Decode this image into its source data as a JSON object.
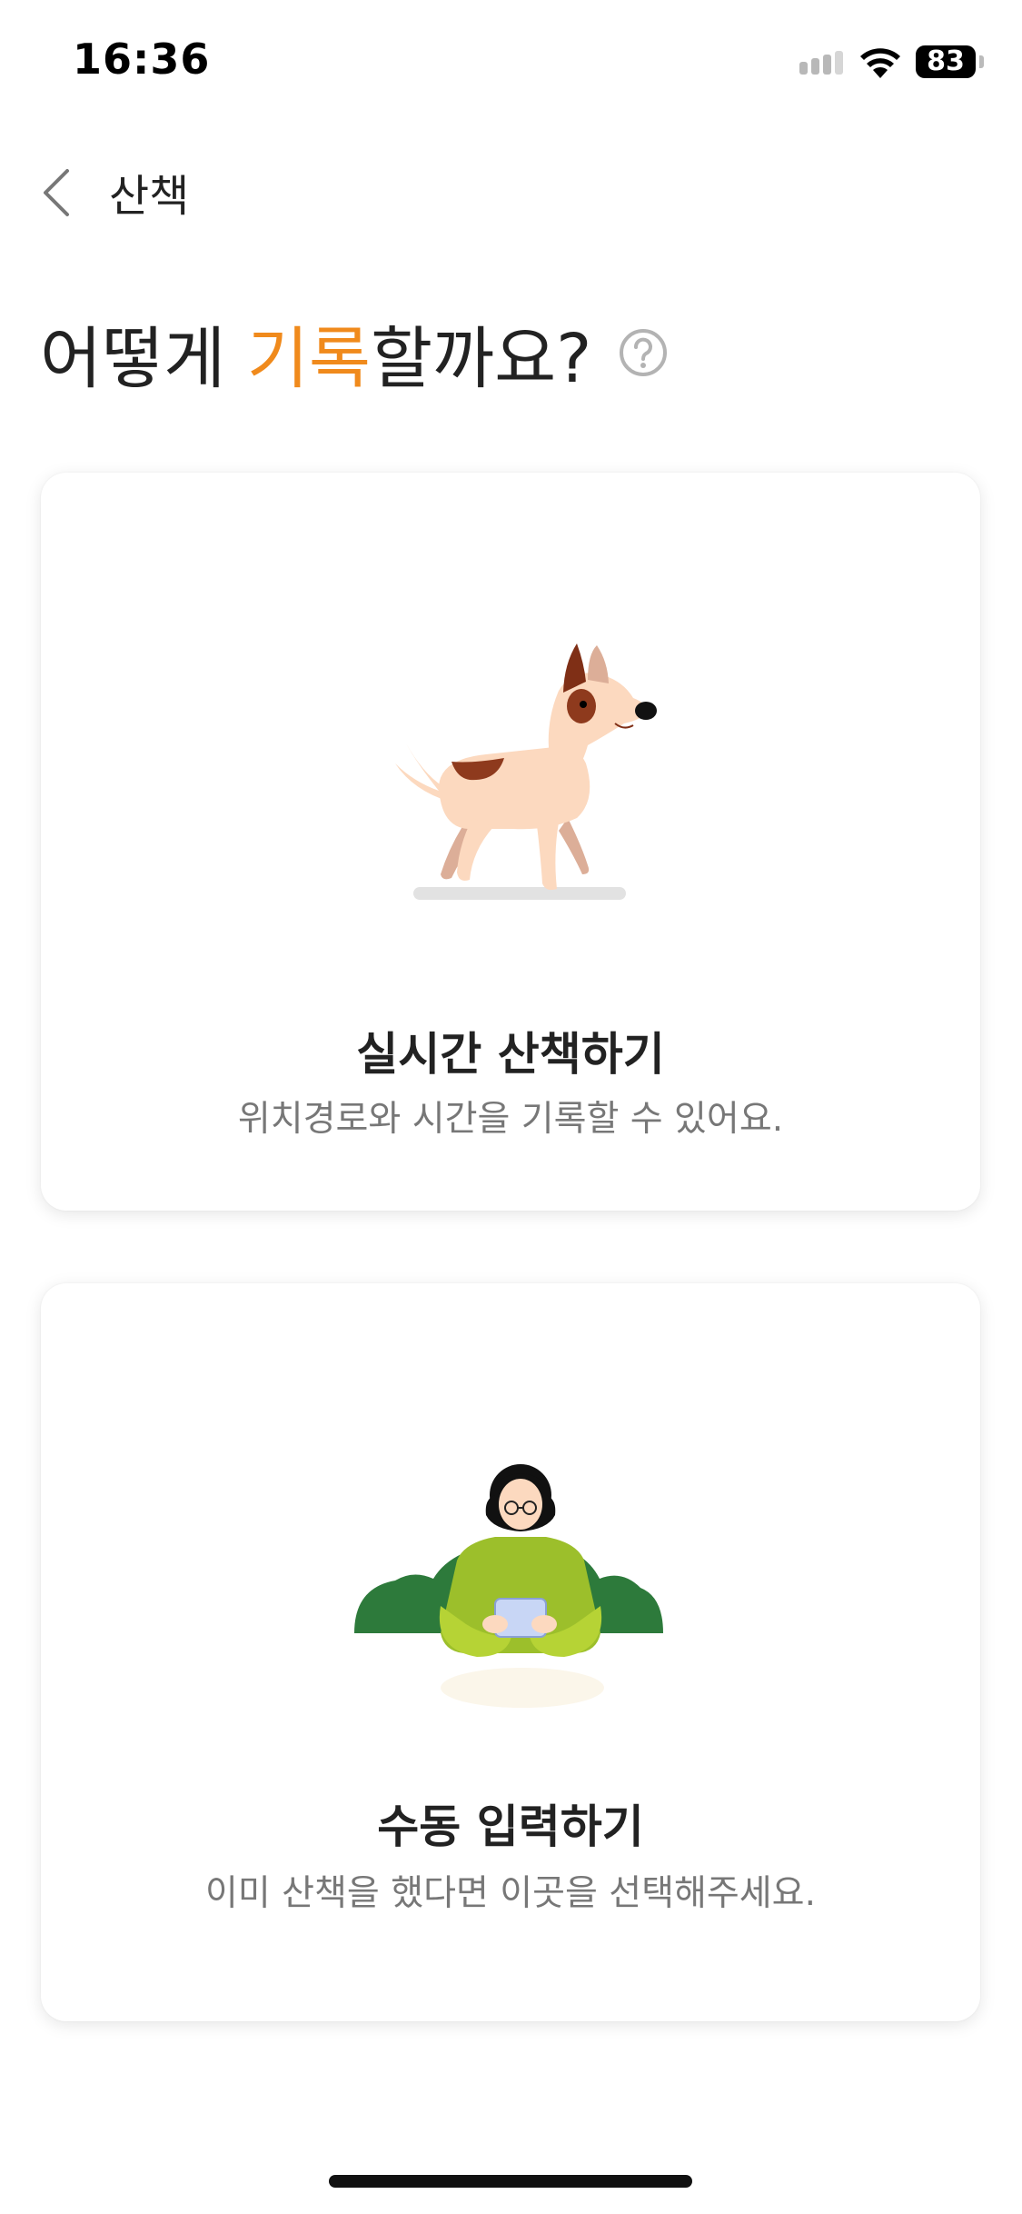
{
  "status_bar": {
    "time": "16:36",
    "battery": "83"
  },
  "nav": {
    "title": "산책",
    "back_icon": "chevron-left-icon"
  },
  "headline": {
    "prefix": "어떻게 ",
    "accent": "기록",
    "suffix": "할까요?",
    "help_icon": "question-circle-icon",
    "accent_color": "#f08a1c"
  },
  "options": {
    "realtime": {
      "title": "실시간 산책하기",
      "description": "위치경로와 시간을 기록할 수 있어요."
    },
    "manual": {
      "title": "수동 입력하기",
      "description": "이미 산책을 했다면 이곳을 선택해주세요."
    }
  }
}
